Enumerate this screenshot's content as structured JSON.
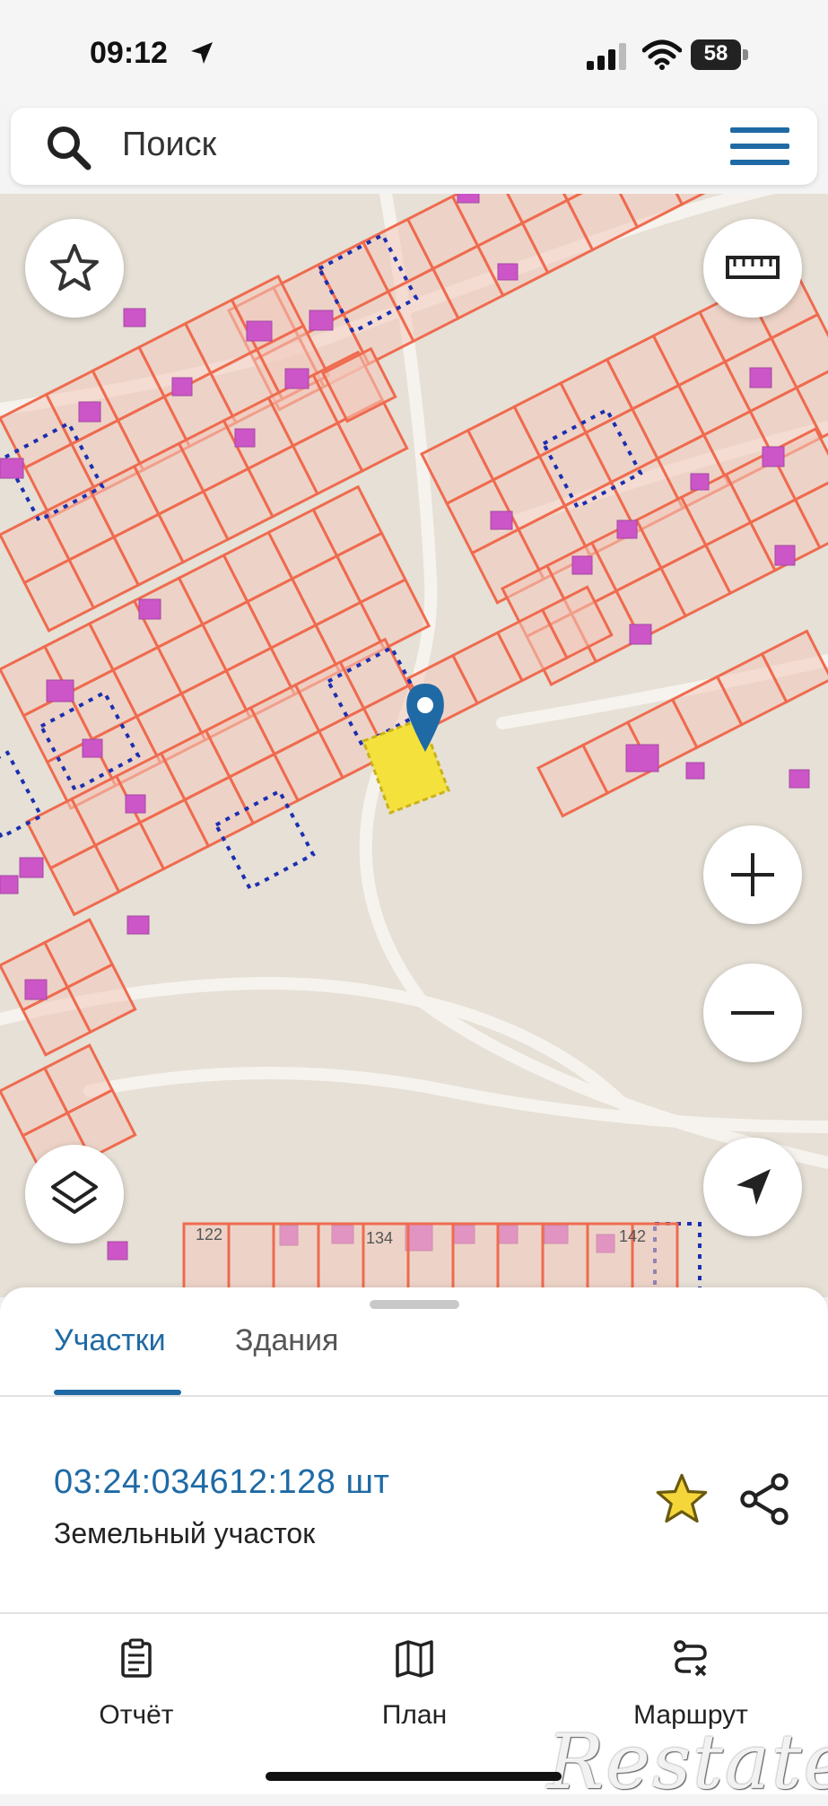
{
  "status_bar": {
    "time": "09:12",
    "battery": "58"
  },
  "search": {
    "placeholder": "Поиск"
  },
  "map": {
    "plot_labels": [
      "122",
      "134",
      "142"
    ],
    "marker_color": "#1f6aa5",
    "selected_plot_color": "#f5e13c"
  },
  "bottom_sheet": {
    "tabs": [
      {
        "label": "Участки",
        "active": true
      },
      {
        "label": "Здания",
        "active": false
      }
    ],
    "result": {
      "cadastral_number": "03:24:034612:128 шт",
      "object_type": "Земельный участок"
    }
  },
  "bottom_nav": {
    "items": [
      {
        "label": "Отчёт",
        "icon": "report-icon"
      },
      {
        "label": "План",
        "icon": "map-icon"
      },
      {
        "label": "Маршрут",
        "icon": "route-icon"
      }
    ]
  },
  "watermark": "Restate"
}
